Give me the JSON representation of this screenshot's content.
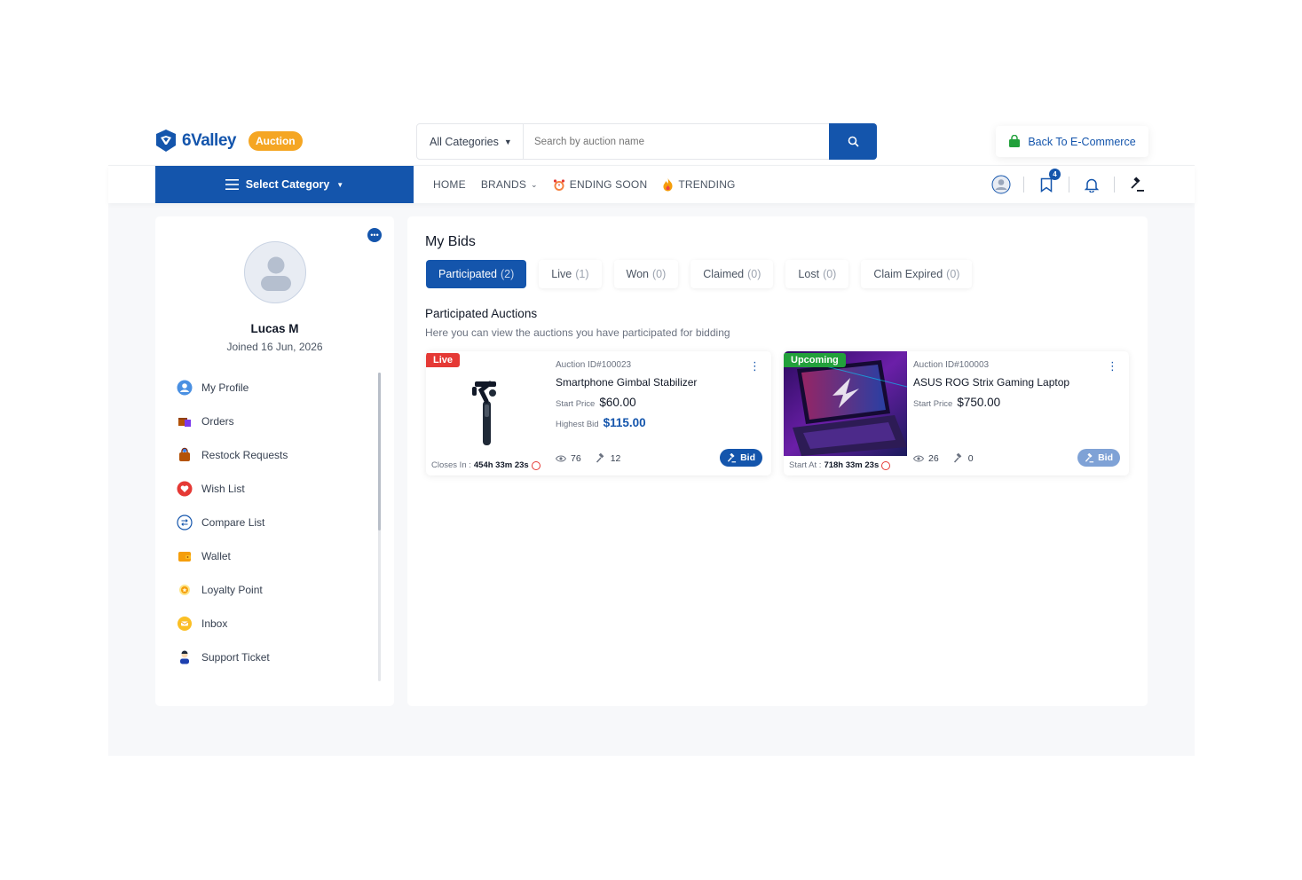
{
  "brand": {
    "name": "6Valley",
    "badge": "Auction"
  },
  "search": {
    "category": "All Categories",
    "placeholder": "Search by auction name"
  },
  "header": {
    "back_label": "Back To E-Commerce"
  },
  "nav": {
    "select_category": "Select Category",
    "links": [
      "HOME",
      "BRANDS",
      "ENDING SOON",
      "TRENDING"
    ],
    "wishlist_count": "4"
  },
  "profile": {
    "name": "Lucas M",
    "joined": "Joined 16 Jun, 2026"
  },
  "sidebar": {
    "items": [
      {
        "label": "My Profile",
        "icon": "user-icon"
      },
      {
        "label": "Orders",
        "icon": "orders-box-icon"
      },
      {
        "label": "Restock Requests",
        "icon": "restock-bag-icon"
      },
      {
        "label": "Wish List",
        "icon": "heart-icon"
      },
      {
        "label": "Compare List",
        "icon": "compare-icon"
      },
      {
        "label": "Wallet",
        "icon": "wallet-icon"
      },
      {
        "label": "Loyalty Point",
        "icon": "loyalty-star-icon"
      },
      {
        "label": "Inbox",
        "icon": "inbox-chat-icon"
      },
      {
        "label": "Support Ticket",
        "icon": "support-agent-icon"
      }
    ]
  },
  "main": {
    "title": "My Bids",
    "tabs": [
      {
        "label": "Participated",
        "count": "(2)",
        "active": true
      },
      {
        "label": "Live",
        "count": "(1)"
      },
      {
        "label": "Won",
        "count": "(0)"
      },
      {
        "label": "Claimed",
        "count": "(0)"
      },
      {
        "label": "Lost",
        "count": "(0)"
      },
      {
        "label": "Claim Expired",
        "count": "(0)"
      }
    ],
    "section_title": "Participated Auctions",
    "section_subtitle": "Here you can view the auctions you have participated for bidding"
  },
  "cards": [
    {
      "status": "Live",
      "timer_label": "Closes In :",
      "timer_value": "454h 33m 23s",
      "auction_id": "Auction ID#100023",
      "name": "Smartphone Gimbal Stabilizer",
      "start_price_label": "Start Price",
      "start_price": "$60.00",
      "highest_bid_label": "Highest Bid",
      "highest_bid": "$115.00",
      "views": "76",
      "bids": "12",
      "bid_label": "Bid"
    },
    {
      "status": "Upcoming",
      "timer_label": "Start At :",
      "timer_value": "718h 33m 23s",
      "auction_id": "Auction ID#100003",
      "name": "ASUS ROG Strix Gaming Laptop",
      "start_price_label": "Start Price",
      "start_price": "$750.00",
      "views": "26",
      "bids": "0",
      "bid_label": "Bid"
    }
  ],
  "colors": {
    "primary": "#1455ac",
    "live": "#e53935",
    "upcoming": "#22a03b",
    "auction_badge": "#f5a623"
  }
}
